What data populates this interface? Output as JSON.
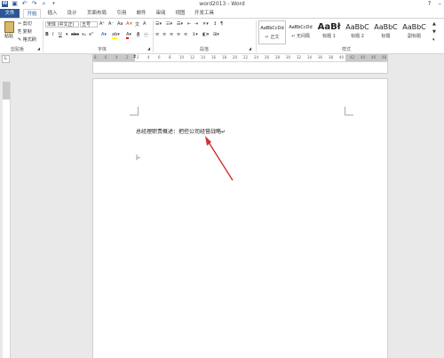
{
  "window": {
    "title": "word2013 - Word"
  },
  "tabs": [
    "文件",
    "开始",
    "插入",
    "设计",
    "页面布局",
    "引用",
    "邮件",
    "审阅",
    "视图",
    "开发工具"
  ],
  "active_tab_index": 1,
  "clipboard": {
    "paste_label": "粘贴",
    "cut_label": "剪切",
    "copy_label": "复制",
    "format_painter_label": "格式刷",
    "group_label": "剪贴板"
  },
  "font": {
    "font_name": "宋体 (中文正)",
    "font_size": "五号",
    "group_label": "字体"
  },
  "paragraph": {
    "group_label": "段落"
  },
  "styles": {
    "group_label": "样式",
    "items": [
      {
        "sample": "AaBbCcDd",
        "name": "↵ 正文",
        "selected": true
      },
      {
        "sample": "AaBbCcDd",
        "name": "↵ 无间隔",
        "selected": false
      },
      {
        "sample": "AaBł",
        "name": "标题 1",
        "selected": false
      },
      {
        "sample": "AaBbC",
        "name": "标题 2",
        "selected": false
      },
      {
        "sample": "AaBbC",
        "name": "标题",
        "selected": false
      },
      {
        "sample": "AaBbC",
        "name": "副标题",
        "selected": false
      }
    ]
  },
  "ruler": {
    "numbers": [
      "8",
      "6",
      "4",
      "2",
      "2",
      "4",
      "6",
      "8",
      "10",
      "12",
      "14",
      "16",
      "18",
      "20",
      "22",
      "24",
      "26",
      "28",
      "30",
      "32",
      "34",
      "36",
      "38",
      "40",
      "42",
      "44",
      "46",
      "48"
    ]
  },
  "document": {
    "text": "总经理职责概述：把控公司经营战略↵",
    "cursor_mark": "↵"
  },
  "annotation": {
    "arrow_color": "#d0312d"
  },
  "colors": {
    "brand": "#2b579a",
    "font_color": "#ff0000",
    "highlight": "#ffff00"
  }
}
